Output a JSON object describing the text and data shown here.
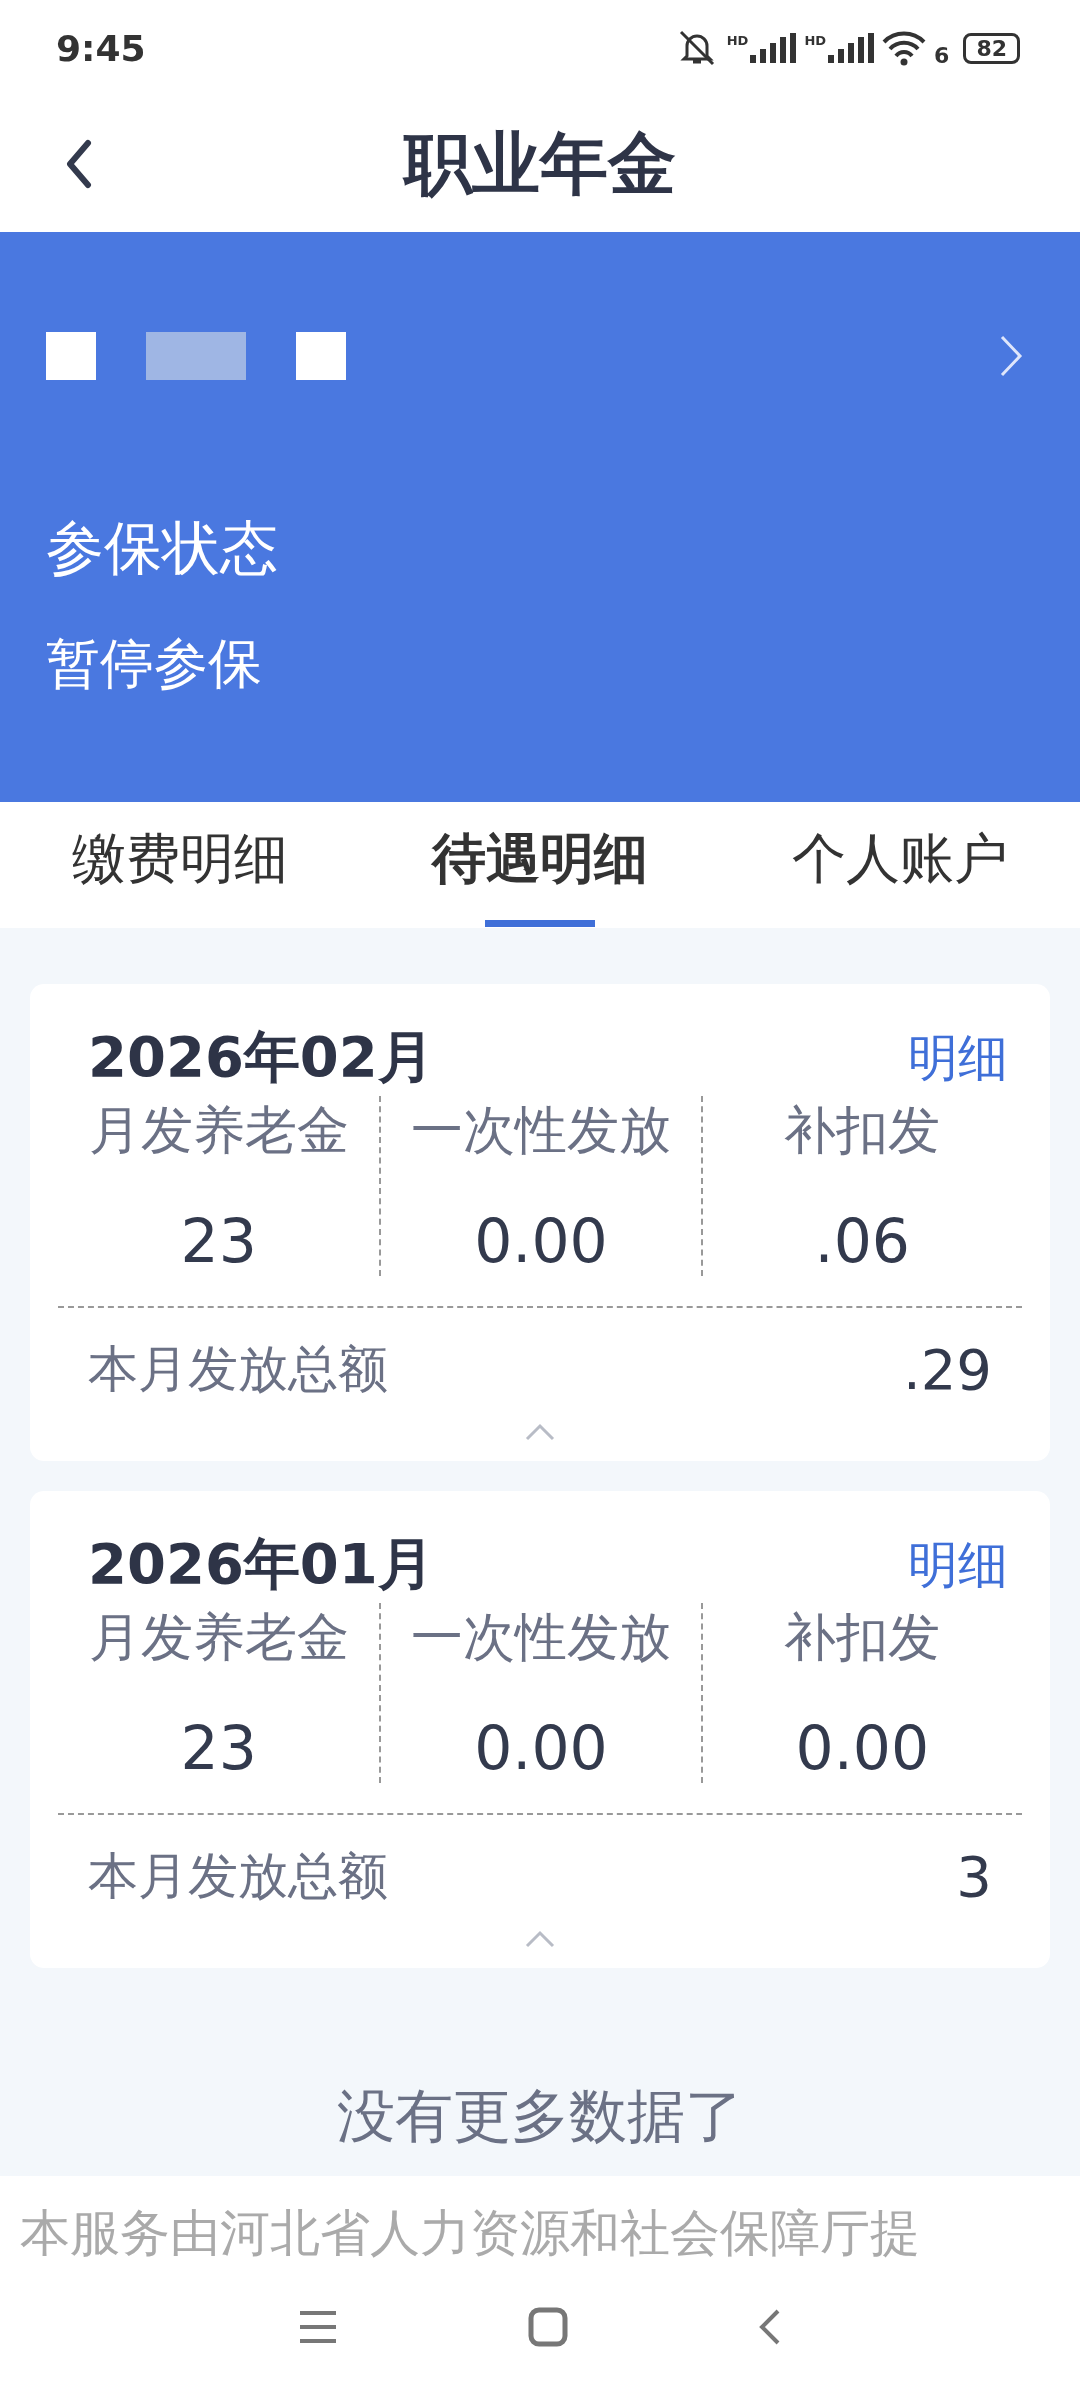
{
  "status_bar": {
    "time": "9:45",
    "signal_labels": [
      "HD",
      "HD"
    ],
    "wifi_label": "6",
    "battery": "82"
  },
  "header": {
    "title": "职业年金"
  },
  "banner": {
    "label": "参保状态",
    "status": "暂停参保"
  },
  "tabs": [
    {
      "label": "缴费明细",
      "selected": false
    },
    {
      "label": "待遇明细",
      "selected": true
    },
    {
      "label": "个人账户",
      "selected": false
    }
  ],
  "records": [
    {
      "month": "2026年02月",
      "detail_link": "明细",
      "columns": [
        {
          "label": "月发养老金",
          "value": "23"
        },
        {
          "label": "一次性发放",
          "value": "0.00"
        },
        {
          "label": "补扣发",
          "value": ".06"
        }
      ],
      "total_label": "本月发放总额",
      "total_value": ".29",
      "expanded": true
    },
    {
      "month": "2026年01月",
      "detail_link": "明细",
      "columns": [
        {
          "label": "月发养老金",
          "value": "23"
        },
        {
          "label": "一次性发放",
          "value": "0.00"
        },
        {
          "label": "补扣发",
          "value": "0.00"
        }
      ],
      "total_label": "本月发放总额",
      "total_value": "3",
      "expanded": true
    }
  ],
  "end_message": "没有更多数据了",
  "footer_note": "本服务由河北省人力资源和社会保障厅提"
}
